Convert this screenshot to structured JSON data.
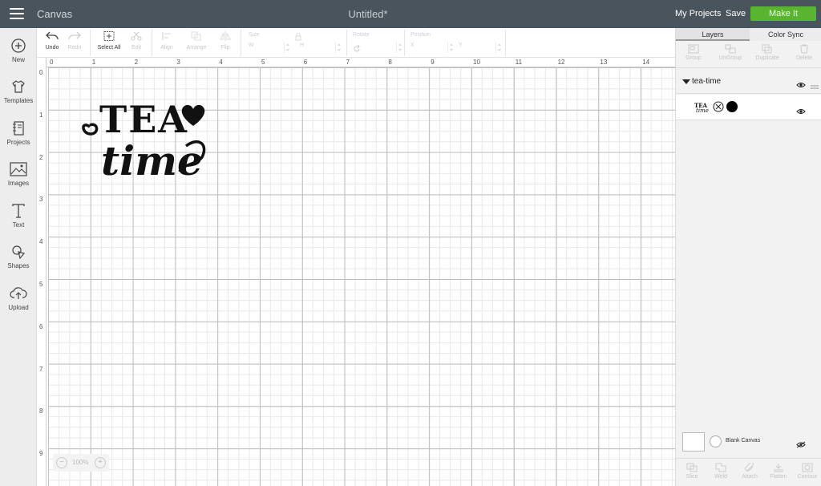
{
  "header": {
    "app_title": "Canvas",
    "doc_title": "Untitled*",
    "my_projects": "My Projects",
    "save": "Save",
    "make_it": "Make It",
    "make_it_color": "#59b52f",
    "bar_color": "#4a545d"
  },
  "sidebar": {
    "items": [
      {
        "label": "New",
        "icon": "plus-circle-icon"
      },
      {
        "label": "Templates",
        "icon": "shirt-icon"
      },
      {
        "label": "Projects",
        "icon": "notebook-icon"
      },
      {
        "label": "Images",
        "icon": "image-icon"
      },
      {
        "label": "Text",
        "icon": "text-icon"
      },
      {
        "label": "Shapes",
        "icon": "shapes-icon"
      },
      {
        "label": "Upload",
        "icon": "cloud-upload-icon"
      }
    ]
  },
  "toolbar": {
    "undo": "Undo",
    "redo": "Redo",
    "select_all": "Select All",
    "edit": "Edit",
    "align": "Align",
    "arrange": "Arrange",
    "flip": "Flip",
    "size_label": "Size",
    "w_label": "W",
    "h_label": "H",
    "rotate_label": "Rotate",
    "position_label": "Position",
    "x_label": "X",
    "y_label": "Y"
  },
  "canvas": {
    "ruler_top": [
      "0",
      "1",
      "2",
      "3",
      "4",
      "5",
      "6",
      "7",
      "8",
      "9",
      "10",
      "11",
      "12",
      "13",
      "14"
    ],
    "ruler_left": [
      "0",
      "1",
      "2",
      "3",
      "4",
      "5",
      "6",
      "7",
      "8",
      "9"
    ],
    "design_line1": "TEA",
    "design_line2": "time",
    "zoom_level": "100%"
  },
  "right_panel": {
    "tab_layers": "Layers",
    "tab_color_sync": "Color Sync",
    "ops": {
      "group": "Group",
      "ungroup": "UnGroup",
      "duplicate": "Duplicate",
      "delete": "Delete"
    },
    "layer_group_name": "tea-time",
    "blank_canvas": "Blank Canvas",
    "bottom_ops": {
      "slice": "Slice",
      "weld": "Weld",
      "attach": "Attach",
      "flatten": "Flatten",
      "contour": "Contour"
    }
  }
}
